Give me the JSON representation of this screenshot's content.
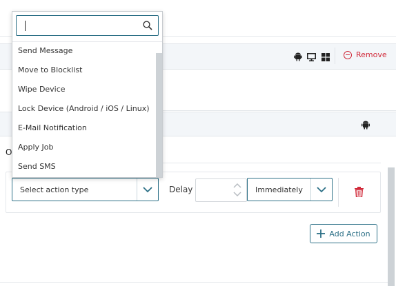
{
  "dropdown": {
    "search_value": "",
    "items": [
      {
        "label": "Send Message"
      },
      {
        "label": "Move to Blocklist"
      },
      {
        "label": "Wipe Device"
      },
      {
        "label": "Lock Device (Android / iOS / Linux)"
      },
      {
        "label": "E-Mail Notification"
      },
      {
        "label": "Apply Job"
      },
      {
        "label": "Send SMS"
      }
    ]
  },
  "header_row": {
    "remove_label": "Remove",
    "platform_icons": [
      "android-icon",
      "monitor-icon",
      "windows-icon"
    ]
  },
  "second_row": {
    "platform_icons": [
      "android-icon"
    ]
  },
  "partial_text": "O",
  "action": {
    "type_placeholder": "Select action type",
    "delay_label": "Delay",
    "delay_value": "",
    "timing_value": "Immediately"
  },
  "add_action_label": "Add Action",
  "colors": {
    "accent": "#2b6f86",
    "danger": "#d12a3a"
  }
}
